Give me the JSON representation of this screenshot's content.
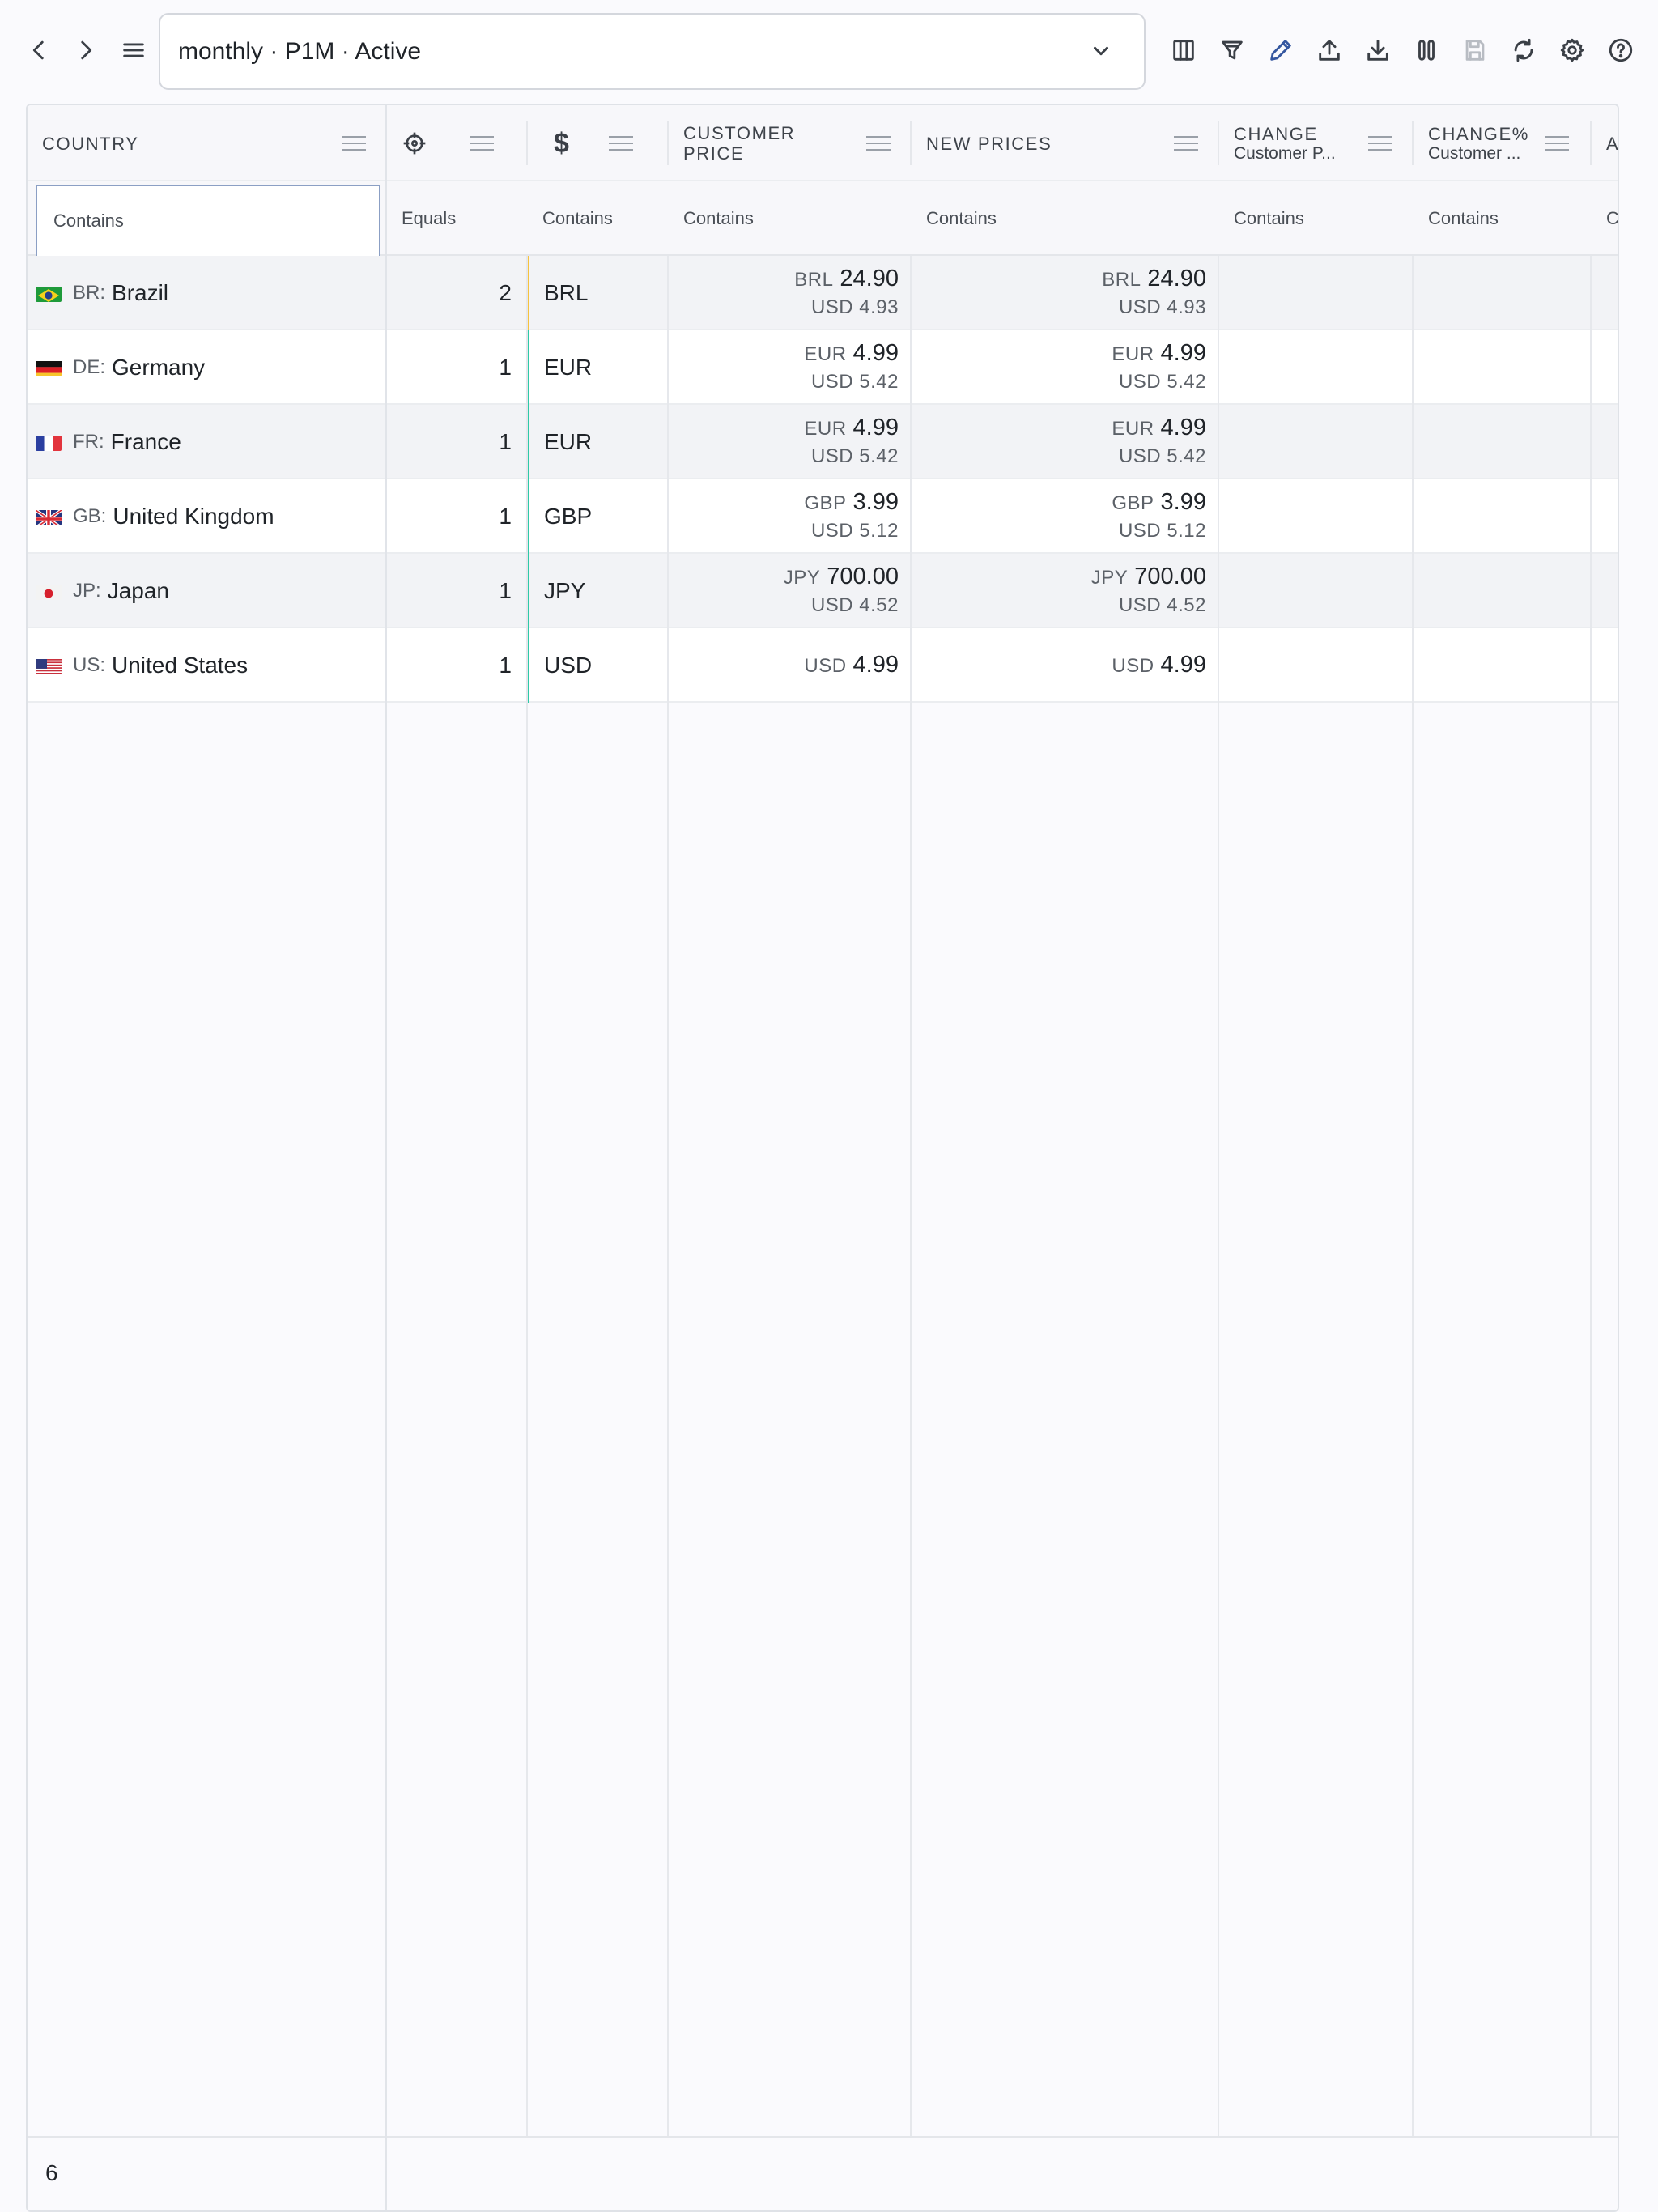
{
  "toolbar": {
    "back_icon": "chevron-left-icon",
    "forward_icon": "chevron-right-icon",
    "menu_icon": "hamburger-menu-icon",
    "view_select": {
      "value": "monthly · P1M · Active"
    },
    "actions": [
      "columns-icon",
      "filter-icon",
      "edit-pencil-icon",
      "upload-icon",
      "download-icon",
      "pause-icon",
      "save-icon",
      "refresh-icon",
      "settings-gear-icon",
      "help-icon"
    ]
  },
  "grid": {
    "columns": {
      "country": {
        "label": "COUNTRY"
      },
      "tier": {
        "icon": "crosshair-icon"
      },
      "currency": {
        "icon": "dollar-icon",
        "label": "$"
      },
      "customer_price": {
        "label": "CUSTOMER PRICE"
      },
      "new_prices": {
        "label": "NEW PRICES"
      },
      "change": {
        "label": "CHANGE",
        "sub": "Customer P..."
      },
      "change_pct": {
        "label": "CHANGE%",
        "sub": "Customer ..."
      },
      "available": {
        "label": "AVA"
      }
    },
    "filters": {
      "country": "Contains",
      "tier": "Equals",
      "currency": "Contains",
      "customer_price": "Contains",
      "new_prices": "Contains",
      "change": "Contains",
      "change_pct": "Contains",
      "available": "Contains"
    },
    "rows": [
      {
        "flag": "BR",
        "code": "BR:",
        "name": "Brazil",
        "tier": "2",
        "status": "#f6c23e",
        "currency": "BRL",
        "cp_cc": "BRL",
        "cp_amt": "24.90",
        "cp_usd": "USD 4.93",
        "np_cc": "BRL",
        "np_amt": "24.90",
        "np_usd": "USD 4.93"
      },
      {
        "flag": "DE",
        "code": "DE:",
        "name": "Germany",
        "tier": "1",
        "status": "#2ec9a7",
        "currency": "EUR",
        "cp_cc": "EUR",
        "cp_amt": "4.99",
        "cp_usd": "USD 5.42",
        "np_cc": "EUR",
        "np_amt": "4.99",
        "np_usd": "USD 5.42"
      },
      {
        "flag": "FR",
        "code": "FR:",
        "name": "France",
        "tier": "1",
        "status": "#2ec9a7",
        "currency": "EUR",
        "cp_cc": "EUR",
        "cp_amt": "4.99",
        "cp_usd": "USD 5.42",
        "np_cc": "EUR",
        "np_amt": "4.99",
        "np_usd": "USD 5.42"
      },
      {
        "flag": "GB",
        "code": "GB:",
        "name": "United Kingdom",
        "tier": "1",
        "status": "#2ec9a7",
        "currency": "GBP",
        "cp_cc": "GBP",
        "cp_amt": "3.99",
        "cp_usd": "USD 5.12",
        "np_cc": "GBP",
        "np_amt": "3.99",
        "np_usd": "USD 5.12"
      },
      {
        "flag": "JP",
        "code": "JP:",
        "name": "Japan",
        "tier": "1",
        "status": "#2ec9a7",
        "currency": "JPY",
        "cp_cc": "JPY",
        "cp_amt": "700.00",
        "cp_usd": "USD 4.52",
        "np_cc": "JPY",
        "np_amt": "700.00",
        "np_usd": "USD 4.52"
      },
      {
        "flag": "US",
        "code": "US:",
        "name": "United States",
        "tier": "1",
        "status": "#2ec9a7",
        "currency": "USD",
        "cp_cc": "USD",
        "cp_amt": "4.99",
        "cp_usd": "",
        "np_cc": "USD",
        "np_amt": "4.99",
        "np_usd": ""
      }
    ],
    "footer": {
      "row_count": "6"
    }
  }
}
